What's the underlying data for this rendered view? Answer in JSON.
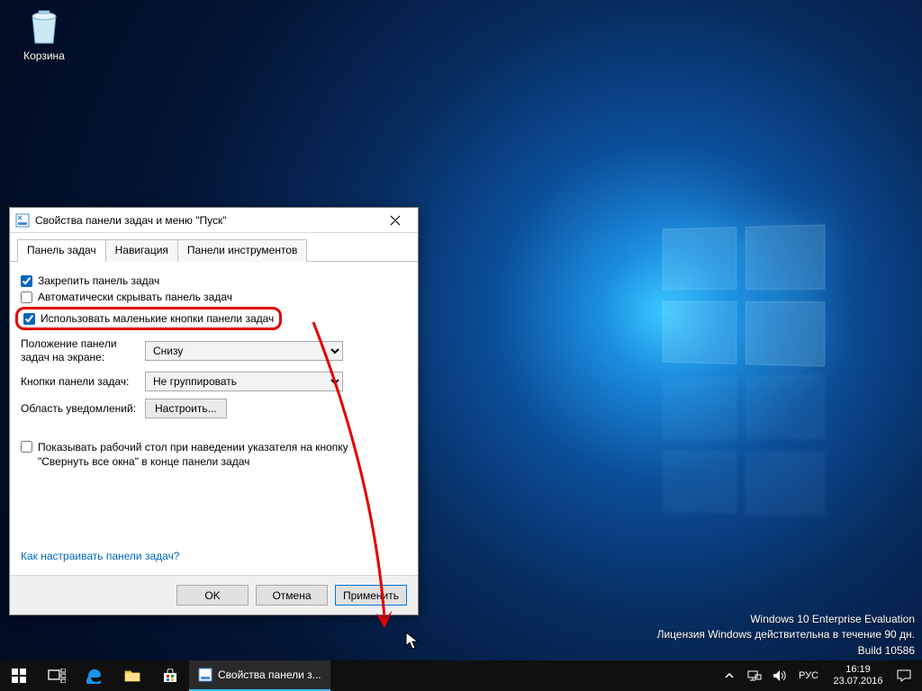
{
  "desktop": {
    "recycle_bin_label": "Корзина"
  },
  "watermark": {
    "line1": "Windows 10 Enterprise Evaluation",
    "line2": "Лицензия Windows действительна в течение 90 дн.",
    "line3": "Build 10586"
  },
  "dialog": {
    "title": "Свойства панели задач и меню \"Пуск\"",
    "tabs": [
      "Панель задач",
      "Навигация",
      "Панели инструментов"
    ],
    "check_lock": "Закрепить панель задач",
    "check_autohide": "Автоматически скрывать панель задач",
    "check_smallbuttons": "Использовать маленькие кнопки панели задач",
    "position_label": "Положение панели задач на экране:",
    "position_value": "Снизу",
    "combine_label": "Кнопки панели задач:",
    "combine_value": "Не группировать",
    "notify_label": "Область уведомлений:",
    "notify_button": "Настроить...",
    "peek_text": "Показывать рабочий стол при наведении указателя на кнопку \"Свернуть все окна\" в конце панели задач",
    "help_link": "Как настраивать панели задач?",
    "btn_ok": "OK",
    "btn_cancel": "Отмена",
    "btn_apply": "Применить"
  },
  "taskbar": {
    "running_item": "Свойства панели з...",
    "lang": "РУС",
    "time": "16:19",
    "date": "23.07.2016"
  }
}
